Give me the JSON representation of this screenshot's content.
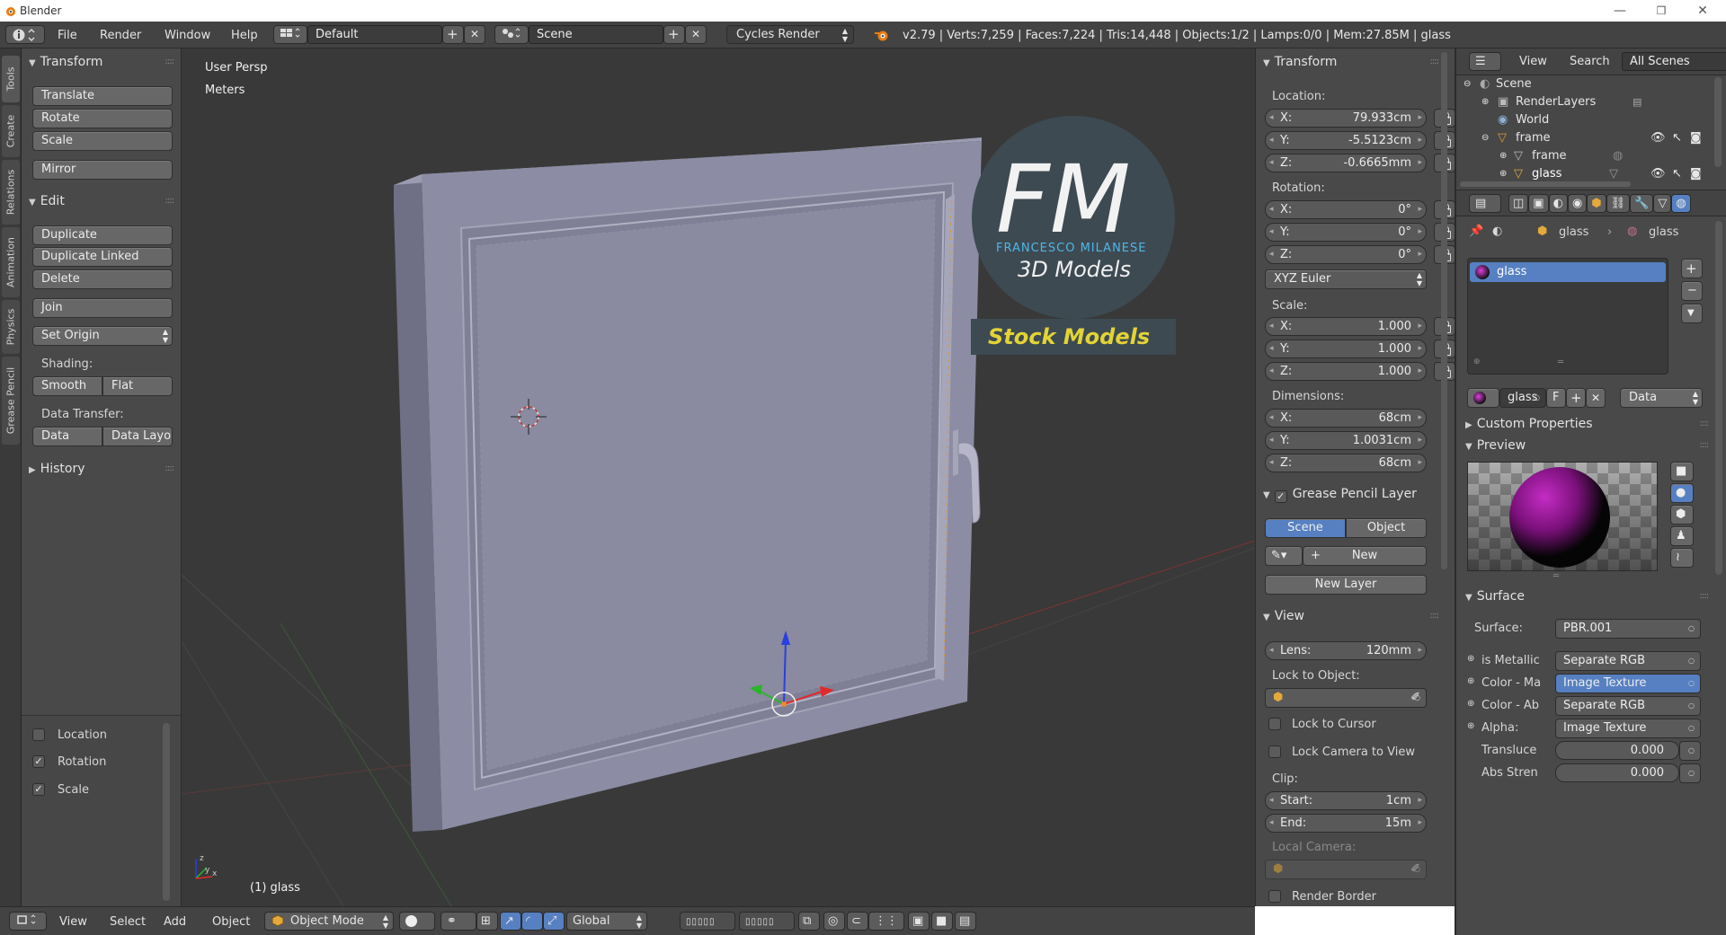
{
  "window": {
    "title": "Blender",
    "minimize": "—",
    "maximize": "❐",
    "close": "✕"
  },
  "infobar": {
    "menus": [
      "File",
      "Render",
      "Window",
      "Help"
    ],
    "layout": "Default",
    "scene": "Scene",
    "engine": "Cycles Render",
    "stats": "v2.79 | Verts:7,259 | Faces:7,224 | Tris:14,448 | Objects:1/2 | Lamps:0/0 | Mem:27.85M | glass"
  },
  "tool_tabs": [
    "Tools",
    "Create",
    "Relations",
    "Animation",
    "Physics",
    "Grease Pencil"
  ],
  "toolshelf": {
    "transform_header": "Transform",
    "translate": "Translate",
    "rotate": "Rotate",
    "scale": "Scale",
    "mirror": "Mirror",
    "edit_header": "Edit",
    "duplicate": "Duplicate",
    "duplicate_linked": "Duplicate Linked",
    "delete": "Delete",
    "join": "Join",
    "set_origin": "Set Origin",
    "shading_label": "Shading:",
    "smooth": "Smooth",
    "flat": "Flat",
    "data_transfer_label": "Data Transfer:",
    "data": "Data",
    "data_layout": "Data Layo",
    "history_header": "History",
    "opt_location": "Location",
    "opt_rotation": "Rotation",
    "opt_scale": "Scale"
  },
  "viewport": {
    "view_name": "User Persp",
    "units": "Meters",
    "object_label": "(1) glass",
    "watermark_big": "FM",
    "watermark_name": "FRANCESCO MILANESE",
    "watermark_sub": "3D Models",
    "watermark_banner": "Stock Models"
  },
  "bottombar": {
    "menus": [
      "View",
      "Select",
      "Add",
      "Object"
    ],
    "mode": "Object Mode",
    "orientation": "Global"
  },
  "npanel": {
    "transform_header": "Transform",
    "location_label": "Location:",
    "loc_x": "79.933cm",
    "loc_y": "-5.5123cm",
    "loc_z": "-0.6665mm",
    "rotation_label": "Rotation:",
    "rot_x": "0°",
    "rot_y": "0°",
    "rot_z": "0°",
    "rotation_mode": "XYZ Euler",
    "scale_label": "Scale:",
    "scl_x": "1.000",
    "scl_y": "1.000",
    "scl_z": "1.000",
    "dimensions_label": "Dimensions:",
    "dim_x": "68cm",
    "dim_y": "1.0031cm",
    "dim_z": "68cm",
    "gp_header": "Grease Pencil Layer",
    "gp_scene": "Scene",
    "gp_object": "Object",
    "gp_new": "New",
    "gp_new_layer": "New Layer",
    "view_header": "View",
    "lens_key": "Lens:",
    "lens": "120mm",
    "lock_object_label": "Lock to Object:",
    "lock_cursor": "Lock to Cursor",
    "lock_camera": "Lock Camera to View",
    "clip_label": "Clip:",
    "clip_start_key": "Start:",
    "clip_start": "1cm",
    "clip_end_key": "End:",
    "clip_end": "15m",
    "local_camera_label": "Local Camera:",
    "render_border": "Render Border"
  },
  "outliner": {
    "view": "View",
    "search": "Search",
    "filter": "All Scenes",
    "rows": [
      "Scene",
      "RenderLayers",
      "World",
      "frame",
      "frame",
      "glass"
    ]
  },
  "properties": {
    "breadcrumb_obj": "glass",
    "breadcrumb_mat": "glass",
    "slot_name": "glass",
    "material_name": "glass",
    "material_f": "F",
    "material_link": "Data",
    "custom_props_header": "Custom Properties",
    "preview_header": "Preview",
    "surface_header": "Surface",
    "surface_label": "Surface:",
    "surface_value": "PBR.001",
    "inputs": [
      {
        "label": "is Metallic",
        "value": "Separate RGB"
      },
      {
        "label": "Color - Ma",
        "value": "Image Texture"
      },
      {
        "label": "Color - Ab",
        "value": "Separate RGB"
      },
      {
        "label": "Alpha:",
        "value": "Image Texture"
      }
    ],
    "translucent_label": "Transluce",
    "translucent_value": "0.000",
    "abs_label": "Abs Stren",
    "abs_value": "0.000"
  },
  "colors": {
    "selection": "#5680c2",
    "viewport_bg": "#393939",
    "object": "#8c8ca6",
    "watermark_circle": "#3f4e56",
    "watermark_accent": "#4fb6e8",
    "banner_text": "#e3d335"
  }
}
